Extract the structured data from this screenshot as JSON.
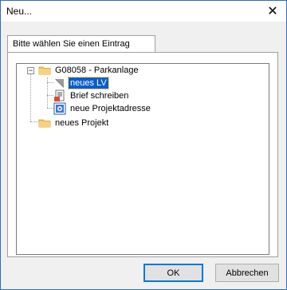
{
  "window": {
    "title": "Neu..."
  },
  "tab": {
    "label": "Bitte wählen Sie einen Eintrag"
  },
  "tree": {
    "items": [
      {
        "label": "G08058 - Parkanlage",
        "icon": "folder-icon"
      },
      {
        "label": "neues LV",
        "icon": "lv-document-icon",
        "selected": true
      },
      {
        "label": "Brief schreiben",
        "icon": "letter-icon"
      },
      {
        "label": "neue Projektadresse",
        "icon": "address-card-icon"
      },
      {
        "label": "neues Projekt",
        "icon": "folder-icon"
      }
    ]
  },
  "buttons": {
    "ok": "OK",
    "cancel": "Abbrechen"
  },
  "colors": {
    "selection": "#0b5ec9",
    "folder": "#f2c35b",
    "window_border": "#2b6cc4"
  }
}
